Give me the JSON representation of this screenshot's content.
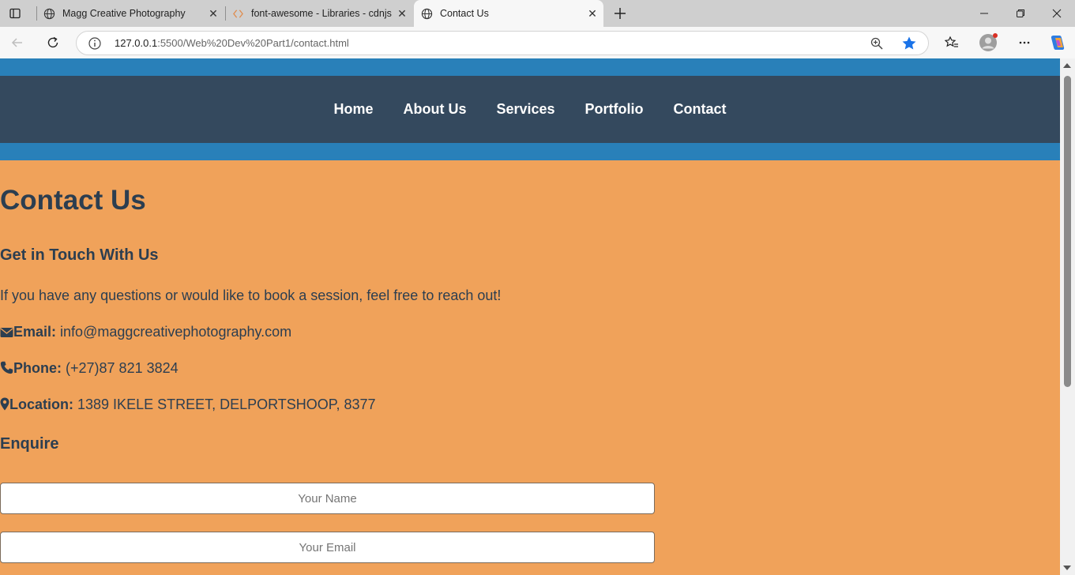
{
  "browser": {
    "tabs": [
      {
        "title": "Magg Creative Photography",
        "icon": "globe-icon"
      },
      {
        "title": "font-awesome - Libraries - cdnjs - T",
        "icon": "code-brackets-icon"
      },
      {
        "title": "Contact Us",
        "icon": "globe-icon"
      }
    ],
    "active_tab": 2,
    "url_host": "127.0.0.1",
    "url_rest": ":5500/Web%20Dev%20Part1/contact.html",
    "accent_color": "#1a73e8"
  },
  "nav": {
    "items": [
      "Home",
      "About Us",
      "Services",
      "Portfolio",
      "Contact"
    ],
    "background": "#34495e",
    "band_color": "#2980b9"
  },
  "page": {
    "background": "#f0a25a",
    "title": "Contact Us",
    "subtitle": "Get in Touch With Us",
    "intro": "If you have any questions or would like to book a session, feel free to reach out!",
    "email_label": "Email:",
    "email_value": "info@maggcreativephotography.com",
    "phone_label": "Phone:",
    "phone_value": "(+27)87 821 3824",
    "location_label": "Location:",
    "location_value": "1389 IKELE STREET, DELPORTSHOOP, 8377",
    "enquire_heading": "Enquire",
    "name_placeholder": "Your Name",
    "email_placeholder": "Your Email"
  }
}
